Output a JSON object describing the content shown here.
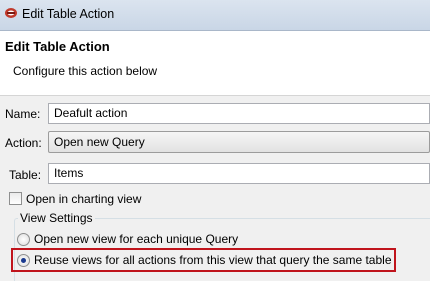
{
  "window": {
    "title": "Edit Table Action",
    "icon": "app-icon"
  },
  "header": {
    "title": "Edit Table Action",
    "description": "Configure this action below"
  },
  "form": {
    "name_label": "Name:",
    "name_value": "Deafult action",
    "action_label": "Action:",
    "action_value": "Open new Query",
    "table_label": "Table:",
    "table_value": "Items",
    "charting_label": "Open in charting view",
    "charting_checked": false
  },
  "view_settings": {
    "title": "View Settings",
    "options": [
      {
        "label": "Open new view for each unique Query",
        "selected": false
      },
      {
        "label": "Reuse views for all actions from this view that query the same table",
        "selected": true
      }
    ],
    "highlight_color": "#c0141c"
  }
}
